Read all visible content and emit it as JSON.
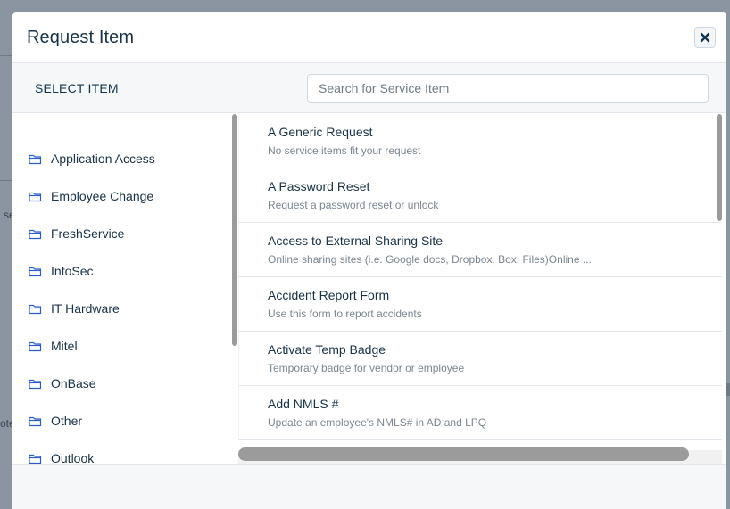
{
  "modal": {
    "title": "Request Item",
    "close_icon": "close-icon"
  },
  "toolbar": {
    "label": "SELECT ITEM",
    "search_placeholder": "Search for Service Item"
  },
  "categories": [
    {
      "label": "Application Access",
      "icon": "folder-icon"
    },
    {
      "label": "Employee Change",
      "icon": "folder-icon"
    },
    {
      "label": "FreshService",
      "icon": "folder-icon"
    },
    {
      "label": "InfoSec",
      "icon": "folder-icon"
    },
    {
      "label": "IT Hardware",
      "icon": "folder-icon"
    },
    {
      "label": "Mitel",
      "icon": "folder-icon"
    },
    {
      "label": "OnBase",
      "icon": "folder-icon"
    },
    {
      "label": "Other",
      "icon": "folder-icon"
    },
    {
      "label": "Outlook",
      "icon": "folder-icon"
    }
  ],
  "service_items": [
    {
      "name": "A Generic Request",
      "description": "No service items fit your request"
    },
    {
      "name": "A Password Reset",
      "description": "Request a password reset or unlock"
    },
    {
      "name": "Access to External Sharing Site",
      "description": "Online sharing sites (i.e. Google docs, Dropbox, Box, Files)Online ..."
    },
    {
      "name": "Accident Report Form",
      "description": "Use this form to report accidents"
    },
    {
      "name": "Activate Temp Badge",
      "description": "Temporary badge for vendor or employee"
    },
    {
      "name": "Add NMLS #",
      "description": "Update an employee's NMLS# in AD and LPQ"
    }
  ],
  "backdrop": {
    "fragment_1": "se",
    "fragment_2": "ote"
  },
  "colors": {
    "text_primary": "#183247",
    "text_secondary": "#7a8691",
    "folder_icon": "#2c5cc5",
    "toolbar_bg": "#f5f7f9",
    "overlay": "#8a95a1"
  }
}
